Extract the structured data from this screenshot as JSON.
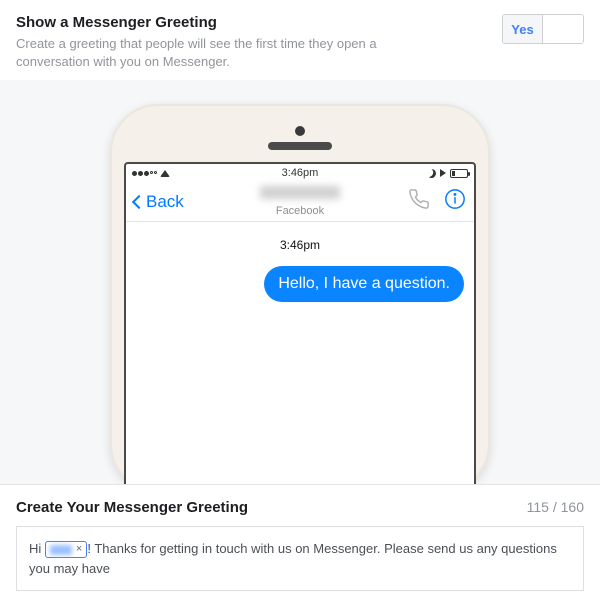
{
  "header": {
    "title": "Show a Messenger Greeting",
    "description": "Create a greeting that people will see the first time they open a conversation with you on Messenger."
  },
  "toggle": {
    "yes": "Yes",
    "no": ""
  },
  "phone": {
    "status_time": "3:46pm",
    "nav": {
      "back": "Back",
      "subtitle": "Facebook"
    },
    "conversation": {
      "timestamp": "3:46pm",
      "message": "Hello, I have a question."
    }
  },
  "greeting": {
    "title": "Create Your Messenger Greeting",
    "counter": "115 / 160",
    "prefix": "Hi ",
    "token_remove": "×",
    "suffix": "! Thanks for getting in touch with us on Messenger. Please send us any questions you may have"
  }
}
